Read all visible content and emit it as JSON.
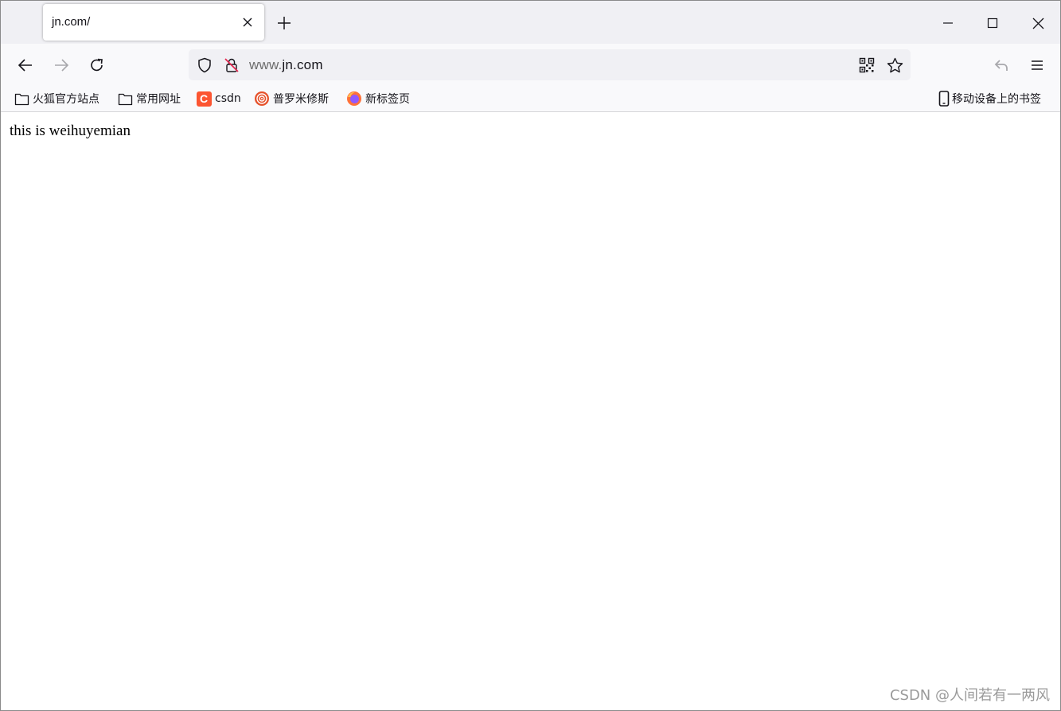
{
  "tab": {
    "title": "jn.com/"
  },
  "urlbar": {
    "host_prefix": "www.",
    "host_main": "jn.com"
  },
  "bookmarks": [
    {
      "label": "火狐官方站点",
      "icon": "folder-icon"
    },
    {
      "label": "常用网址",
      "icon": "folder-icon"
    },
    {
      "label": "csdn",
      "icon": "csdn-icon",
      "icon_text": "C"
    },
    {
      "label": "普罗米修斯",
      "icon": "prometheus-icon"
    },
    {
      "label": "新标签页",
      "icon": "firefox-icon"
    }
  ],
  "mobile_bookmarks": {
    "label": "移动设备上的书签",
    "icon": "mobile-device-icon"
  },
  "page": {
    "text": "this is weihuyemian"
  },
  "watermark": "CSDN @人间若有一两风",
  "colors": {
    "tabstrip": "#f0f0f4",
    "toolbar": "#f9f9fb",
    "urlbar": "#f0f0f4",
    "csdn": "#fc5531",
    "accent": "#e22850"
  }
}
